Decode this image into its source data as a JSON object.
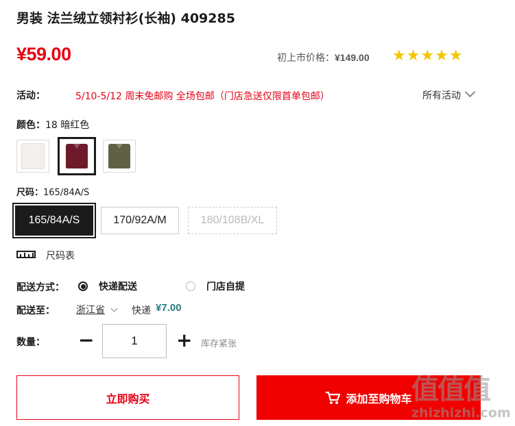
{
  "product": {
    "title": "男装 法兰绒立领衬衫(长袖) 409285",
    "price": "¥59.00",
    "original_price_label": "初上市价格：",
    "original_price": "¥149.00",
    "rating_stars": "★★★★★",
    "rating_value": 5
  },
  "promo": {
    "label": "活动：",
    "text": "5/10-5/12 周末免邮购 全场包邮（门店急送仅限首单包邮）",
    "all_link": "所有活动"
  },
  "color": {
    "label": "颜色：",
    "selected": "18 暗红色",
    "swatches": [
      {
        "name": "white",
        "hex": "#f3f0ee",
        "selected": false
      },
      {
        "name": "dark-red",
        "hex": "#6e1a2b",
        "selected": true
      },
      {
        "name": "olive",
        "hex": "#5f6144",
        "selected": false
      }
    ]
  },
  "size": {
    "label": "尺码：",
    "selected": "165/84A/S",
    "options": [
      {
        "label": "165/84A/S",
        "state": "selected"
      },
      {
        "label": "170/92A/M",
        "state": "available"
      },
      {
        "label": "180/108B/XL",
        "state": "disabled"
      }
    ],
    "chart_link": "尺码表"
  },
  "delivery": {
    "method_label": "配送方式：",
    "options": [
      "快递配送",
      "门店自提"
    ],
    "selected": "快递配送",
    "to_label": "配送至：",
    "province": "浙江省",
    "method": "快递",
    "fee": "¥7.00"
  },
  "quantity": {
    "label": "数量：",
    "value": "1",
    "minus": "−",
    "plus": "+",
    "stock_note": "库存紧张"
  },
  "actions": {
    "buy_now": "立即购买",
    "add_to_cart": "添加至购物车"
  },
  "watermark": {
    "text": "值值值",
    "site": "zhizhizhi.com"
  },
  "colors": {
    "accent": "#e60012",
    "cart_button": "#f10000",
    "star": "#f3c500",
    "fee": "#2c7a83"
  }
}
